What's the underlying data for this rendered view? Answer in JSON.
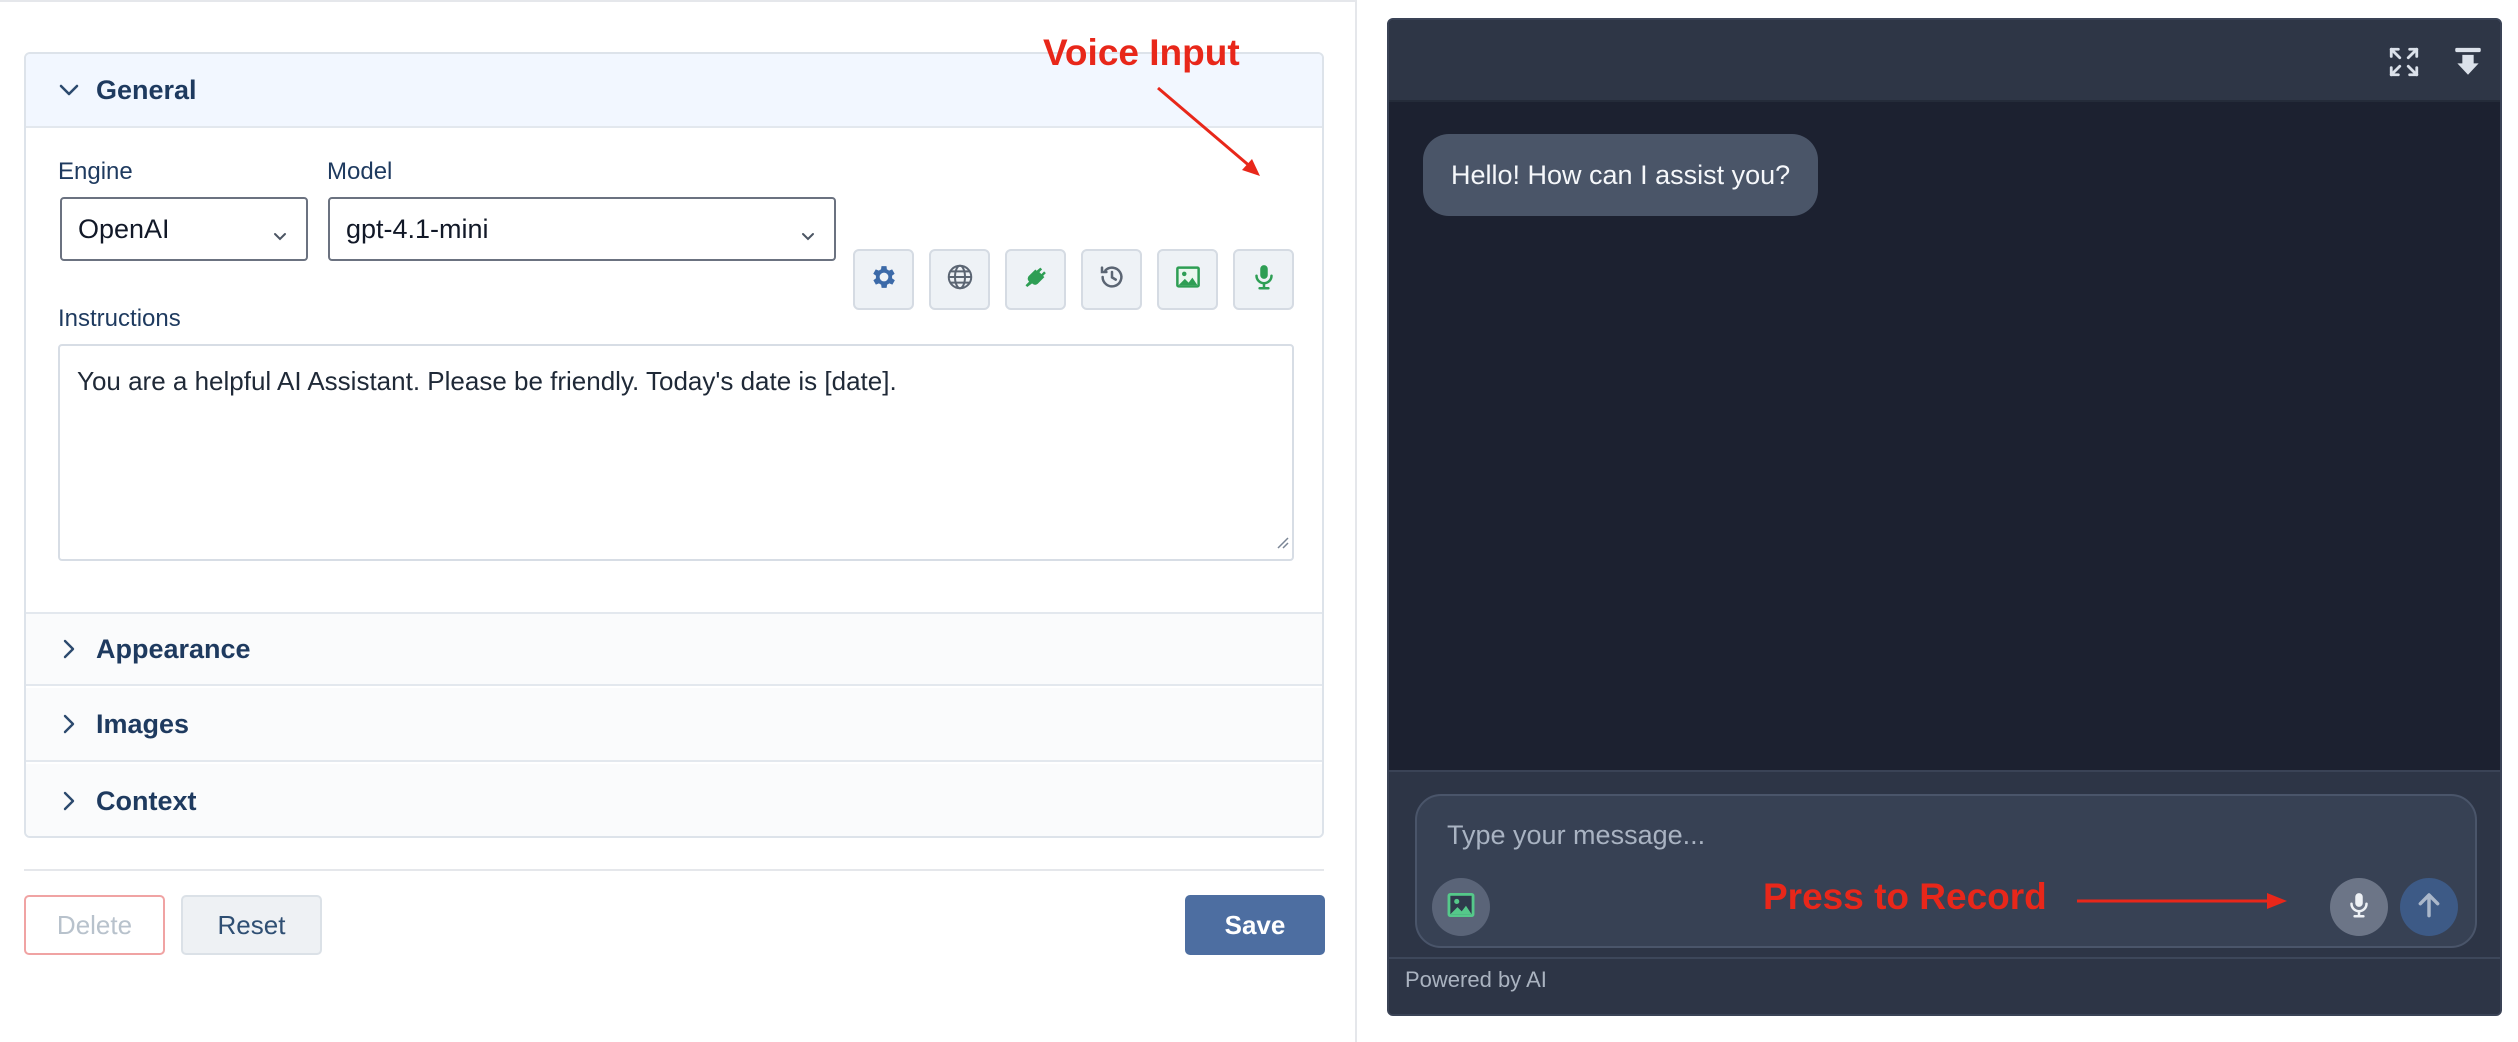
{
  "settings": {
    "general": {
      "title": "General"
    },
    "engine": {
      "label": "Engine",
      "value": "OpenAI"
    },
    "model": {
      "label": "Model",
      "value": "gpt-4.1-mini"
    },
    "toolbar": {
      "icons": [
        "gear-icon",
        "globe-icon",
        "plug-icon",
        "history-icon",
        "image-icon",
        "microphone-icon"
      ]
    },
    "instructions": {
      "label": "Instructions",
      "value": "You are a helpful AI Assistant. Please be friendly. Today's date is [date]."
    },
    "sections": [
      "Appearance",
      "Images",
      "Context"
    ],
    "buttons": {
      "delete": "Delete",
      "reset": "Reset",
      "save": "Save"
    }
  },
  "annotations": {
    "voice_input": "Voice Input",
    "press_to_record": "Press to Record",
    "color": "#e8271a"
  },
  "chat": {
    "header_icons": [
      "expand-icon",
      "download-icon"
    ],
    "greeting": "Hello! How can I assist you?",
    "input_placeholder": "Type your message...",
    "powered_by": "Powered by AI"
  },
  "colors": {
    "accent": "#4d6ea1",
    "green_icon": "#2e9e54",
    "chat_bg": "#1c2130",
    "chat_header": "#2e3646",
    "bubble": "#4a5568"
  }
}
